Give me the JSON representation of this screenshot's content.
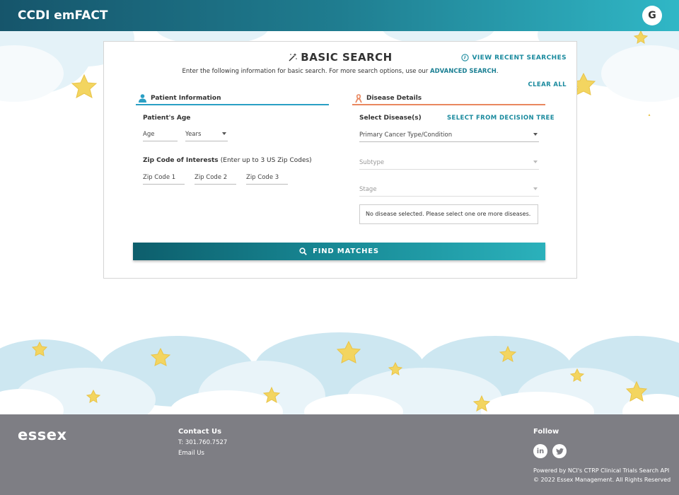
{
  "header": {
    "title": "CCDI emFACT",
    "avatar_initial": "G"
  },
  "search": {
    "title": "BASIC SEARCH",
    "view_recent": "VIEW RECENT SEARCHES",
    "subtitle_prefix": "Enter the following information for basic search. For more search options, use our ",
    "advanced_link": "ADVANCED SEARCH",
    "subtitle_suffix": ".",
    "clear_all": "CLEAR ALL",
    "find_matches": "FIND MATCHES"
  },
  "patient": {
    "section_title": "Patient Information",
    "age_label": "Patient's Age",
    "age_placeholder": "Age",
    "age_unit": "Years",
    "zip_label": "Zip Code of Interests",
    "zip_hint": "(Enter up to 3 US Zip Codes)",
    "zip_placeholders": [
      "Zip Code 1",
      "Zip Code 2",
      "Zip Code 3"
    ]
  },
  "disease": {
    "section_title": "Disease Details",
    "select_label": "Select Disease(s)",
    "decision_tree": "SELECT FROM DECISION TREE",
    "primary_placeholder": "Primary Cancer Type/Condition",
    "subtype_placeholder": "Subtype",
    "stage_placeholder": "Stage",
    "empty_note": "No disease selected. Please select one ore more diseases."
  },
  "footer": {
    "logo": "essex",
    "contact_title": "Contact Us",
    "phone": "T: 301.760.7527",
    "email": "Email Us",
    "follow_title": "Follow",
    "linkedin": "in",
    "powered": "Powered by NCI's CTRP Clinical Trials Search API",
    "copyright": "© 2022 Essex Management. All Rights Reserved"
  },
  "colors": {
    "accent": "#1a8a9e",
    "patient_rule": "#2a9fc4",
    "disease_rule": "#e9875f",
    "footer_bg": "#7e7e84"
  }
}
